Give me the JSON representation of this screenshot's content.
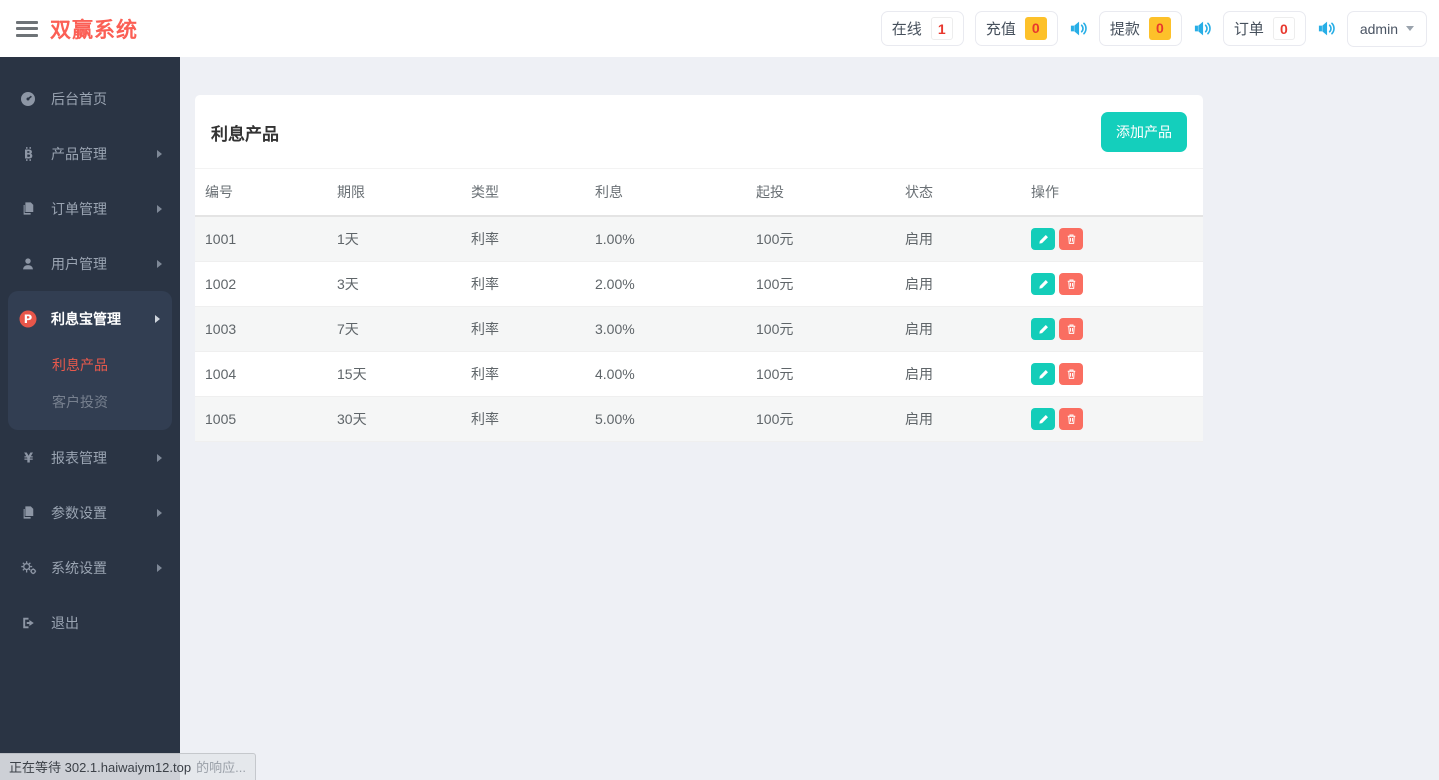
{
  "header": {
    "brand": "双赢系统",
    "stats": [
      {
        "label": "在线",
        "value": "1",
        "badge_style": "outline"
      },
      {
        "label": "充值",
        "value": "0",
        "badge_style": "amber"
      },
      {
        "label": "提款",
        "value": "0",
        "badge_style": "amber"
      },
      {
        "label": "订单",
        "value": "0",
        "badge_style": "outline"
      }
    ],
    "user_menu": {
      "label": "admin"
    }
  },
  "sidebar": {
    "items": [
      {
        "label": "后台首页",
        "icon": "dashboard-icon",
        "has_children": false
      },
      {
        "label": "产品管理",
        "icon": "bitcoin-icon",
        "has_children": true
      },
      {
        "label": "订单管理",
        "icon": "files-icon",
        "has_children": true
      },
      {
        "label": "用户管理",
        "icon": "user-icon",
        "has_children": true
      },
      {
        "label": "利息宝管理",
        "icon": "pinterest-icon",
        "has_children": true,
        "active": true,
        "children": [
          {
            "label": "利息产品",
            "active": true
          },
          {
            "label": "客户投资",
            "active": false
          }
        ]
      },
      {
        "label": "报表管理",
        "icon": "yen-icon",
        "has_children": true
      },
      {
        "label": "参数设置",
        "icon": "files-icon",
        "has_children": true
      },
      {
        "label": "系统设置",
        "icon": "gears-icon",
        "has_children": true
      },
      {
        "label": "退出",
        "icon": "logout-icon",
        "has_children": false
      }
    ]
  },
  "main": {
    "panel_title": "利息产品",
    "add_button_label": "添加产品",
    "table": {
      "columns": [
        "编号",
        "期限",
        "类型",
        "利息",
        "起投",
        "状态",
        "操作"
      ],
      "rows": [
        {
          "id": "1001",
          "term": "1天",
          "type": "利率",
          "interest": "1.00%",
          "min_invest": "100元",
          "status": "启用"
        },
        {
          "id": "1002",
          "term": "3天",
          "type": "利率",
          "interest": "2.00%",
          "min_invest": "100元",
          "status": "启用"
        },
        {
          "id": "1003",
          "term": "7天",
          "type": "利率",
          "interest": "3.00%",
          "min_invest": "100元",
          "status": "启用"
        },
        {
          "id": "1004",
          "term": "15天",
          "type": "利率",
          "interest": "4.00%",
          "min_invest": "100元",
          "status": "启用"
        },
        {
          "id": "1005",
          "term": "30天",
          "type": "利率",
          "interest": "5.00%",
          "min_invest": "100元",
          "status": "启用"
        }
      ]
    }
  },
  "statusbar": {
    "loading_host": "正在等待 302.1.haiwaiym12.top",
    "loading_suffix": "的响应..."
  },
  "colors": {
    "brand_red": "#fb5f55",
    "teal_accent": "#14cfbc",
    "delete_red": "#fa6e61",
    "amber_badge": "#fdc12a",
    "count_red": "#e8382e",
    "speaker_blue": "#27aee6",
    "submenu_active_red": "#e8594c",
    "sidebar_bg": "#2a3444",
    "sidebar_active_bg": "#323e52",
    "content_bg": "#eef0f5"
  }
}
